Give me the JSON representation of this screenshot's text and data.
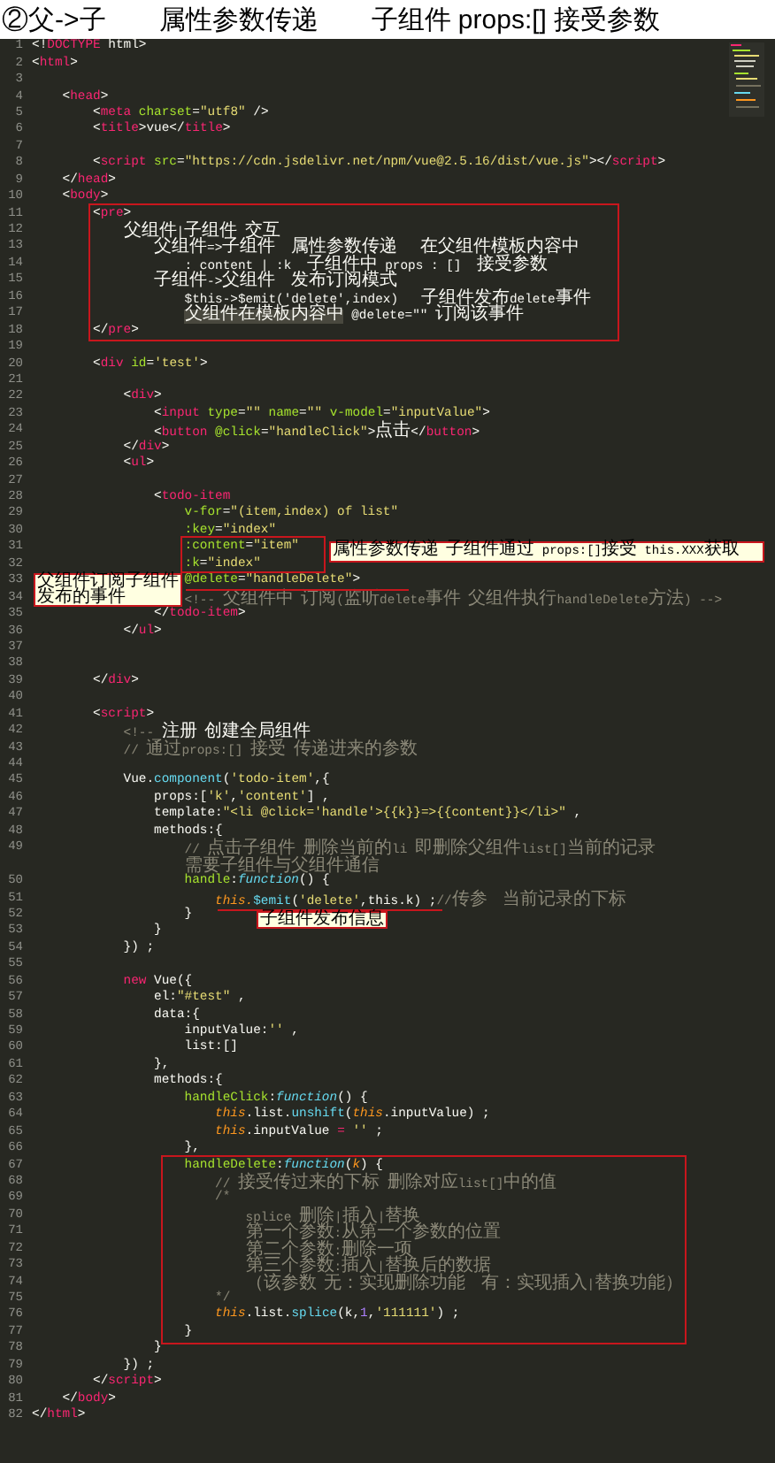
{
  "title": "②父->子　　属性参数传递　　子组件 props:[] 接受参数",
  "lines": [
    {
      "number": "1",
      "tokens": [
        {
          "kind": "p",
          "text": "<!"
        },
        {
          "kind": "tag",
          "text": "DOCTYPE"
        },
        {
          "kind": "p",
          "text": " html>"
        }
      ]
    },
    {
      "number": "2",
      "tokens": [
        {
          "kind": "p",
          "text": "<"
        },
        {
          "kind": "tag",
          "text": "html"
        },
        {
          "kind": "p",
          "text": ">"
        }
      ]
    },
    {
      "number": "3"
    },
    {
      "number": "4",
      "tokens": [
        {
          "kind": "p",
          "text": "    <"
        },
        {
          "kind": "tag",
          "text": "head"
        },
        {
          "kind": "p",
          "text": ">"
        }
      ]
    },
    {
      "number": "5",
      "tokens": [
        {
          "kind": "p",
          "text": "        <"
        },
        {
          "kind": "tag",
          "text": "meta"
        },
        {
          "kind": "attr",
          "text": " charset"
        },
        {
          "kind": "p",
          "text": "="
        },
        {
          "kind": "str",
          "text": "\"utf8\""
        },
        {
          "kind": "p",
          "text": " />"
        }
      ]
    },
    {
      "number": "6",
      "tokens": [
        {
          "kind": "p",
          "text": "        <"
        },
        {
          "kind": "tag",
          "text": "title"
        },
        {
          "kind": "p",
          "text": ">vue</"
        },
        {
          "kind": "tag",
          "text": "title"
        },
        {
          "kind": "p",
          "text": ">"
        }
      ]
    },
    {
      "number": "7"
    },
    {
      "number": "8",
      "tokens": [
        {
          "kind": "p",
          "text": "        <"
        },
        {
          "kind": "tag",
          "text": "script"
        },
        {
          "kind": "attr",
          "text": " src"
        },
        {
          "kind": "p",
          "text": "="
        },
        {
          "kind": "str",
          "text": "\"https://cdn.jsdelivr.net/npm/vue@2.5.16/dist/vue.js\""
        },
        {
          "kind": "p",
          "text": "></"
        },
        {
          "kind": "tag",
          "text": "script"
        },
        {
          "kind": "p",
          "text": ">"
        }
      ]
    },
    {
      "number": "9",
      "tokens": [
        {
          "kind": "p",
          "text": "    </"
        },
        {
          "kind": "tag",
          "text": "head"
        },
        {
          "kind": "p",
          "text": ">"
        }
      ]
    },
    {
      "number": "10",
      "tokens": [
        {
          "kind": "p",
          "text": "    <"
        },
        {
          "kind": "tag",
          "text": "body"
        },
        {
          "kind": "p",
          "text": ">"
        }
      ]
    },
    {
      "number": "11",
      "tokens": [
        {
          "kind": "p",
          "text": "        <"
        },
        {
          "kind": "tag",
          "text": "pre"
        },
        {
          "kind": "p",
          "text": ">"
        }
      ]
    },
    {
      "number": "12",
      "tokens": [
        {
          "kind": "p",
          "text": "            父组件|子组件 交互"
        }
      ]
    },
    {
      "number": "13",
      "tokens": [
        {
          "kind": "p",
          "text": "                父组件=>子组件  属性参数传递   在父组件模板内容中"
        }
      ]
    },
    {
      "number": "14",
      "tokens": [
        {
          "kind": "p",
          "text": "                    : content | :k  子组件中 props : []  接受参数"
        }
      ]
    },
    {
      "number": "15",
      "tokens": [
        {
          "kind": "p",
          "text": "                子组件->父组件  发布订阅模式"
        }
      ]
    },
    {
      "number": "16",
      "tokens": [
        {
          "kind": "p",
          "text": "                    $this->$emit('delete',index)   子组件发布delete事件"
        }
      ]
    },
    {
      "number": "17",
      "tokens": [
        {
          "kind": "sel",
          "text": "                    父组件在模板内容中"
        },
        {
          "kind": "p",
          "text": " @delete=\"\" 订阅该事件"
        }
      ]
    },
    {
      "number": "18",
      "tokens": [
        {
          "kind": "p",
          "text": "        </"
        },
        {
          "kind": "tag",
          "text": "pre"
        },
        {
          "kind": "p",
          "text": ">"
        }
      ]
    },
    {
      "number": "19"
    },
    {
      "number": "20",
      "tokens": [
        {
          "kind": "p",
          "text": "        <"
        },
        {
          "kind": "tag",
          "text": "div"
        },
        {
          "kind": "attr",
          "text": " id"
        },
        {
          "kind": "p",
          "text": "="
        },
        {
          "kind": "str",
          "text": "'test'"
        },
        {
          "kind": "p",
          "text": ">"
        }
      ]
    },
    {
      "number": "21"
    },
    {
      "number": "22",
      "tokens": [
        {
          "kind": "p",
          "text": "            <"
        },
        {
          "kind": "tag",
          "text": "div"
        },
        {
          "kind": "p",
          "text": ">"
        }
      ]
    },
    {
      "number": "23",
      "tokens": [
        {
          "kind": "p",
          "text": "                <"
        },
        {
          "kind": "tag",
          "text": "input"
        },
        {
          "kind": "attr",
          "text": " type"
        },
        {
          "kind": "p",
          "text": "="
        },
        {
          "kind": "str",
          "text": "\"\""
        },
        {
          "kind": "attr",
          "text": " name"
        },
        {
          "kind": "p",
          "text": "="
        },
        {
          "kind": "str",
          "text": "\"\""
        },
        {
          "kind": "attr",
          "text": " v-model"
        },
        {
          "kind": "p",
          "text": "="
        },
        {
          "kind": "str",
          "text": "\"inputValue\""
        },
        {
          "kind": "p",
          "text": ">"
        }
      ]
    },
    {
      "number": "24",
      "tokens": [
        {
          "kind": "p",
          "text": "                <"
        },
        {
          "kind": "tag",
          "text": "button"
        },
        {
          "kind": "attr",
          "text": " @click"
        },
        {
          "kind": "p",
          "text": "="
        },
        {
          "kind": "str",
          "text": "\"handleClick\""
        },
        {
          "kind": "p",
          "text": ">点击</"
        },
        {
          "kind": "tag",
          "text": "button"
        },
        {
          "kind": "p",
          "text": ">"
        }
      ]
    },
    {
      "number": "25",
      "tokens": [
        {
          "kind": "p",
          "text": "            </"
        },
        {
          "kind": "tag",
          "text": "div"
        },
        {
          "kind": "p",
          "text": ">"
        }
      ]
    },
    {
      "number": "26",
      "tokens": [
        {
          "kind": "p",
          "text": "            <"
        },
        {
          "kind": "tag",
          "text": "ul"
        },
        {
          "kind": "p",
          "text": ">"
        }
      ]
    },
    {
      "number": "27"
    },
    {
      "number": "28",
      "tokens": [
        {
          "kind": "p",
          "text": "                <"
        },
        {
          "kind": "tag",
          "text": "todo-item"
        }
      ]
    },
    {
      "number": "29",
      "tokens": [
        {
          "kind": "attr",
          "text": "                    v-for"
        },
        {
          "kind": "p",
          "text": "="
        },
        {
          "kind": "str",
          "text": "\"(item,index) of list\""
        }
      ]
    },
    {
      "number": "30",
      "tokens": [
        {
          "kind": "attr",
          "text": "                    :key"
        },
        {
          "kind": "p",
          "text": "="
        },
        {
          "kind": "str",
          "text": "\"index\""
        }
      ]
    },
    {
      "number": "31",
      "tokens": [
        {
          "kind": "attr",
          "text": "                    :content"
        },
        {
          "kind": "p",
          "text": "="
        },
        {
          "kind": "str",
          "text": "\"item\""
        }
      ]
    },
    {
      "number": "32",
      "tokens": [
        {
          "kind": "attr",
          "text": "                    :k"
        },
        {
          "kind": "p",
          "text": "="
        },
        {
          "kind": "str",
          "text": "\"index\""
        }
      ]
    },
    {
      "number": "33",
      "tokens": [
        {
          "kind": "attr",
          "text": "                    @delete"
        },
        {
          "kind": "p",
          "text": "="
        },
        {
          "kind": "str",
          "text": "\"handleDelete\""
        },
        {
          "kind": "p",
          "text": ">"
        }
      ]
    },
    {
      "number": "34",
      "tokens": [
        {
          "kind": "cmt",
          "text": "                    <!-- 父组件中 订阅(监听delete事件 父组件执行handleDelete方法) -->"
        }
      ]
    },
    {
      "number": "35",
      "tokens": [
        {
          "kind": "p",
          "text": "                </"
        },
        {
          "kind": "tag",
          "text": "todo-item"
        },
        {
          "kind": "p",
          "text": ">"
        }
      ]
    },
    {
      "number": "36",
      "tokens": [
        {
          "kind": "p",
          "text": "            </"
        },
        {
          "kind": "tag",
          "text": "ul"
        },
        {
          "kind": "p",
          "text": ">"
        }
      ]
    },
    {
      "number": "37"
    },
    {
      "number": "38"
    },
    {
      "number": "39",
      "tokens": [
        {
          "kind": "p",
          "text": "        </"
        },
        {
          "kind": "tag",
          "text": "div"
        },
        {
          "kind": "p",
          "text": ">"
        }
      ]
    },
    {
      "number": "40"
    },
    {
      "number": "41",
      "tokens": [
        {
          "kind": "p",
          "text": "        <"
        },
        {
          "kind": "tag",
          "text": "script"
        },
        {
          "kind": "p",
          "text": ">"
        }
      ]
    },
    {
      "number": "42",
      "tokens": [
        {
          "kind": "cmt",
          "text": "            <!-- "
        },
        {
          "kind": "p",
          "text": "注册 创建全局组件"
        }
      ]
    },
    {
      "number": "43",
      "tokens": [
        {
          "kind": "cmt",
          "text": "            // 通过props:[] 接受 传递进来的参数"
        }
      ]
    },
    {
      "number": "44"
    },
    {
      "number": "45",
      "tokens": [
        {
          "kind": "p",
          "text": "            Vue."
        },
        {
          "kind": "meth",
          "text": "component"
        },
        {
          "kind": "p",
          "text": "("
        },
        {
          "kind": "str",
          "text": "'todo-item'"
        },
        {
          "kind": "p",
          "text": ",{"
        }
      ]
    },
    {
      "number": "46",
      "tokens": [
        {
          "kind": "p",
          "text": "                props:["
        },
        {
          "kind": "str",
          "text": "'k'"
        },
        {
          "kind": "p",
          "text": ","
        },
        {
          "kind": "str",
          "text": "'content'"
        },
        {
          "kind": "p",
          "text": "] ,"
        }
      ]
    },
    {
      "number": "47",
      "tokens": [
        {
          "kind": "p",
          "text": "                template:"
        },
        {
          "kind": "str",
          "text": "\"<li @click='handle'>{{k}}=>{{content}}</li>\""
        },
        {
          "kind": "p",
          "text": " ,"
        }
      ]
    },
    {
      "number": "48",
      "tokens": [
        {
          "kind": "p",
          "text": "                methods:{"
        }
      ]
    },
    {
      "number": "49",
      "tokens": [
        {
          "kind": "cmt",
          "text": "                    // 点击子组件 删除当前的li 即删除父组件list[]当前的记录"
        }
      ]
    },
    {
      "tokens": [
        {
          "kind": "cmt",
          "text": "                    需要子组件与父组件通信"
        }
      ]
    },
    {
      "number": "50",
      "tokens": [
        {
          "kind": "attr",
          "text": "                    handle"
        },
        {
          "kind": "p",
          "text": ":"
        },
        {
          "kind": "fn",
          "text": "function"
        },
        {
          "kind": "p",
          "text": "() {"
        }
      ]
    },
    {
      "number": "51",
      "tokens": [
        {
          "kind": "th",
          "text": "                        this."
        },
        {
          "kind": "meth",
          "text": "$emit"
        },
        {
          "kind": "p",
          "text": "("
        },
        {
          "kind": "str",
          "text": "'delete'"
        },
        {
          "kind": "p",
          "text": ",this"
        },
        {
          "kind": "p",
          "text": ".k) ;"
        },
        {
          "kind": "cmt",
          "text": "//传参  当前记录的下标"
        }
      ]
    },
    {
      "number": "52",
      "tokens": [
        {
          "kind": "p",
          "text": "                    }"
        }
      ]
    },
    {
      "number": "53",
      "tokens": [
        {
          "kind": "p",
          "text": "                }"
        }
      ]
    },
    {
      "number": "54",
      "tokens": [
        {
          "kind": "p",
          "text": "            }) ;"
        }
      ]
    },
    {
      "number": "55"
    },
    {
      "number": "56",
      "tokens": [
        {
          "kind": "kw",
          "text": "            new"
        },
        {
          "kind": "p",
          "text": " Vue({"
        }
      ]
    },
    {
      "number": "57",
      "tokens": [
        {
          "kind": "p",
          "text": "                el:"
        },
        {
          "kind": "str",
          "text": "\"#test\""
        },
        {
          "kind": "p",
          "text": " ,"
        }
      ]
    },
    {
      "number": "58",
      "tokens": [
        {
          "kind": "p",
          "text": "                data:{"
        }
      ]
    },
    {
      "number": "59",
      "tokens": [
        {
          "kind": "p",
          "text": "                    inputValue:"
        },
        {
          "kind": "str",
          "text": "''"
        },
        {
          "kind": "p",
          "text": " ,"
        }
      ]
    },
    {
      "number": "60",
      "tokens": [
        {
          "kind": "p",
          "text": "                    list:[]"
        }
      ]
    },
    {
      "number": "61",
      "tokens": [
        {
          "kind": "p",
          "text": "                },"
        }
      ]
    },
    {
      "number": "62",
      "tokens": [
        {
          "kind": "p",
          "text": "                methods:{"
        }
      ]
    },
    {
      "number": "63",
      "tokens": [
        {
          "kind": "attr",
          "text": "                    handleClick"
        },
        {
          "kind": "p",
          "text": ":"
        },
        {
          "kind": "fn",
          "text": "function"
        },
        {
          "kind": "p",
          "text": "() {"
        }
      ]
    },
    {
      "number": "64",
      "tokens": [
        {
          "kind": "th",
          "text": "                        this"
        },
        {
          "kind": "p",
          "text": ".list."
        },
        {
          "kind": "meth",
          "text": "unshift"
        },
        {
          "kind": "p",
          "text": "("
        },
        {
          "kind": "th",
          "text": "this"
        },
        {
          "kind": "p",
          "text": ".inputValue) ;"
        }
      ]
    },
    {
      "number": "65",
      "tokens": [
        {
          "kind": "th",
          "text": "                        this"
        },
        {
          "kind": "p",
          "text": ".inputValue "
        },
        {
          "kind": "kw",
          "text": "="
        },
        {
          "kind": "str",
          "text": " ''"
        },
        {
          "kind": "p",
          "text": " ;"
        }
      ]
    },
    {
      "number": "66",
      "tokens": [
        {
          "kind": "p",
          "text": "                    },"
        }
      ]
    },
    {
      "number": "67",
      "tokens": [
        {
          "kind": "attr",
          "text": "                    handleDelete"
        },
        {
          "kind": "p",
          "text": ":"
        },
        {
          "kind": "fn",
          "text": "function"
        },
        {
          "kind": "p",
          "text": "("
        },
        {
          "kind": "prm",
          "text": "k"
        },
        {
          "kind": "p",
          "text": ") {"
        }
      ]
    },
    {
      "number": "68",
      "tokens": [
        {
          "kind": "cmt",
          "text": "                        // 接受传过来的下标 删除对应list[]中的值"
        }
      ]
    },
    {
      "number": "69",
      "tokens": [
        {
          "kind": "cmt",
          "text": "                        /*"
        }
      ]
    },
    {
      "number": "70",
      "tokens": [
        {
          "kind": "cmt",
          "text": "                            splice 删除|插入|替换"
        }
      ]
    },
    {
      "number": "71",
      "tokens": [
        {
          "kind": "cmt",
          "text": "                            第一个参数:从第一个参数的位置"
        }
      ]
    },
    {
      "number": "72",
      "tokens": [
        {
          "kind": "cmt",
          "text": "                            第二个参数:删除一项"
        }
      ]
    },
    {
      "number": "73",
      "tokens": [
        {
          "kind": "cmt",
          "text": "                            第三个参数:插入|替换后的数据"
        }
      ]
    },
    {
      "number": "74",
      "tokens": [
        {
          "kind": "cmt",
          "text": "                            （该参数 无：实现删除功能  有：实现插入|替换功能）"
        }
      ]
    },
    {
      "number": "75",
      "tokens": [
        {
          "kind": "cmt",
          "text": "                        */"
        }
      ]
    },
    {
      "number": "76",
      "tokens": [
        {
          "kind": "th",
          "text": "                        this"
        },
        {
          "kind": "p",
          "text": ".list."
        },
        {
          "kind": "meth",
          "text": "splice"
        },
        {
          "kind": "p",
          "text": "(k,"
        },
        {
          "kind": "num",
          "text": "1"
        },
        {
          "kind": "p",
          "text": ","
        },
        {
          "kind": "str",
          "text": "'111111'"
        },
        {
          "kind": "p",
          "text": ") ;"
        }
      ]
    },
    {
      "number": "77",
      "tokens": [
        {
          "kind": "p",
          "text": "                    }"
        }
      ]
    },
    {
      "number": "78",
      "tokens": [
        {
          "kind": "p",
          "text": "                }"
        }
      ]
    },
    {
      "number": "79",
      "tokens": [
        {
          "kind": "p",
          "text": "            }) ;"
        }
      ]
    },
    {
      "number": "80",
      "tokens": [
        {
          "kind": "p",
          "text": "        </"
        },
        {
          "kind": "tag",
          "text": "script"
        },
        {
          "kind": "p",
          "text": ">"
        }
      ]
    },
    {
      "number": "81",
      "tokens": [
        {
          "kind": "p",
          "text": "    </"
        },
        {
          "kind": "tag",
          "text": "body"
        },
        {
          "kind": "p",
          "text": ">"
        }
      ]
    },
    {
      "number": "82",
      "tokens": [
        {
          "kind": "p",
          "text": "</"
        },
        {
          "kind": "tag",
          "text": "html"
        },
        {
          "kind": "p",
          "text": ">"
        }
      ]
    }
  ],
  "notes": [
    {
      "text": "属性参数传递 子组件通过 props:[]接受 this.XXX获取"
    },
    {
      "text": "父组件订阅子组件发布的事件"
    },
    {
      "text": "子组件发布信息"
    }
  ]
}
